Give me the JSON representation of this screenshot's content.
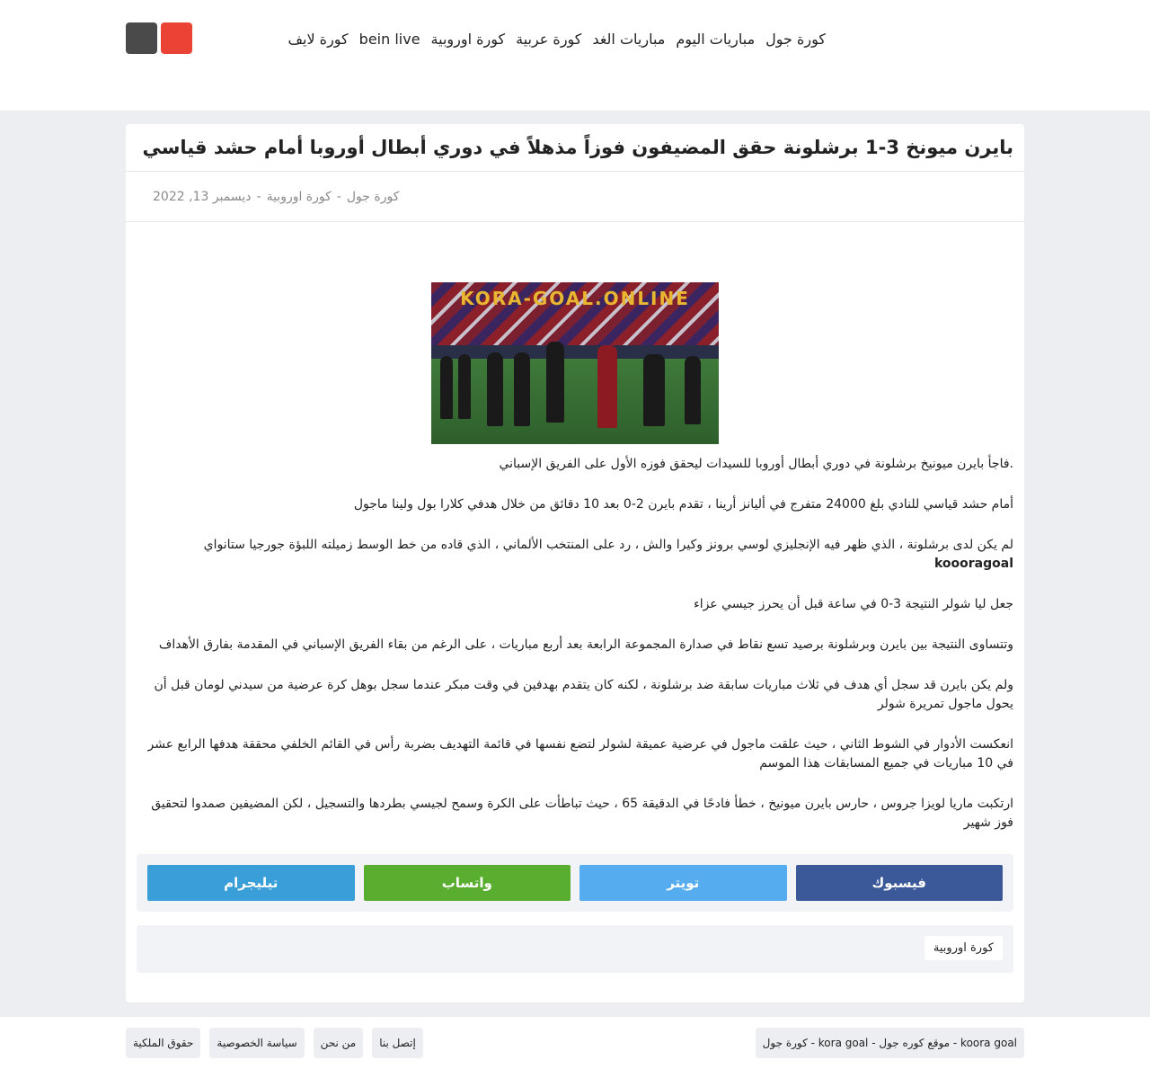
{
  "header": {
    "nav": [
      "كورة جول",
      "مباريات اليوم",
      "مباريات الغد",
      "كورة عربية",
      "كورة اوروبية",
      "bein live",
      "كورة لايف"
    ],
    "colors": {
      "dark_button": "#4a4a4a",
      "red_button": "#ea4335"
    }
  },
  "article": {
    "title": "بايرن ميونخ 3-1 برشلونة حقق المضيفون فوزاً مذهلاً في دوري أبطال أوروبا أمام حشد قياسي",
    "meta": {
      "site": "كورة جول",
      "category": "كورة اوروبية",
      "date": "ديسمبر 13, 2022"
    },
    "image_text": "KORA-GOAL.ONLINE",
    "paragraphs": [
      ".فاجأ بايرن ميونيخ برشلونة في دوري أبطال أوروبا للسيدات ليحقق فوزه الأول على الفريق الإسباني",
      "أمام حشد قياسي للنادي بلغ 24000 متفرج في أليانز أرينا ، تقدم بايرن 2-0 بعد 10 دقائق من خلال هدفي كلارا بول ولينا ماجول",
      "لم يكن لدى برشلونة ، الذي ظهر فيه الإنجليزي لوسي برونز وكيرا والش ، رد على المنتخب الألماني ، الذي قاده من خط الوسط زميلته اللبؤة جورجيا ستانواي",
      "جعل ليا شولر النتيجة 3-0 في ساعة قبل أن يحرز جيسي عزاء",
      "وتتساوى النتيجة بين بايرن وبرشلونة برصيد تسع نقاط في صدارة المجموعة الرابعة بعد أربع مباريات ، على الرغم من بقاء الفريق الإسباني في المقدمة بفارق الأهداف",
      "ولم يكن بايرن قد سجل أي هدف في ثلاث مباريات سابقة ضد برشلونة ، لكنه كان يتقدم بهدفين في وقت مبكر عندما سجل بوهل كرة عرضية من سيدني لومان قبل أن يحول ماجول تمريرة شولر",
      "انعكست الأدوار في الشوط الثاني ، حيث علقت ماجول في عرضية عميقة لشولر لتضع نفسها في قائمة التهديف بضربة رأس في القائم الخلفي محققة هدفها الرابع عشر في 10 مباريات في جميع المسابقات هذا الموسم",
      "ارتكبت ماريا لويزا جروس ، حارس بايرن ميونيخ ، خطأ فادحًا في الدقيقة 65 ، حيث تباطأت على الكرة وسمح لجيسي بطردها والتسجيل ، لكن المضيفين صمدوا لتحقيق فوز شهير"
    ],
    "strong_text": "koooragoal"
  },
  "share": {
    "facebook": "فيسبوك",
    "twitter": "تويتر",
    "whatsapp": "واتساب",
    "telegram": "تيليجرام"
  },
  "tags": [
    "كورة اوروبية"
  ],
  "footer": {
    "copyright": "koora goal - موقع كوره جول - kora goal - كورة جول",
    "links": [
      "إتصل بنا",
      "من نحن",
      "سياسة الخصوصية",
      "حقوق الملكية"
    ]
  }
}
